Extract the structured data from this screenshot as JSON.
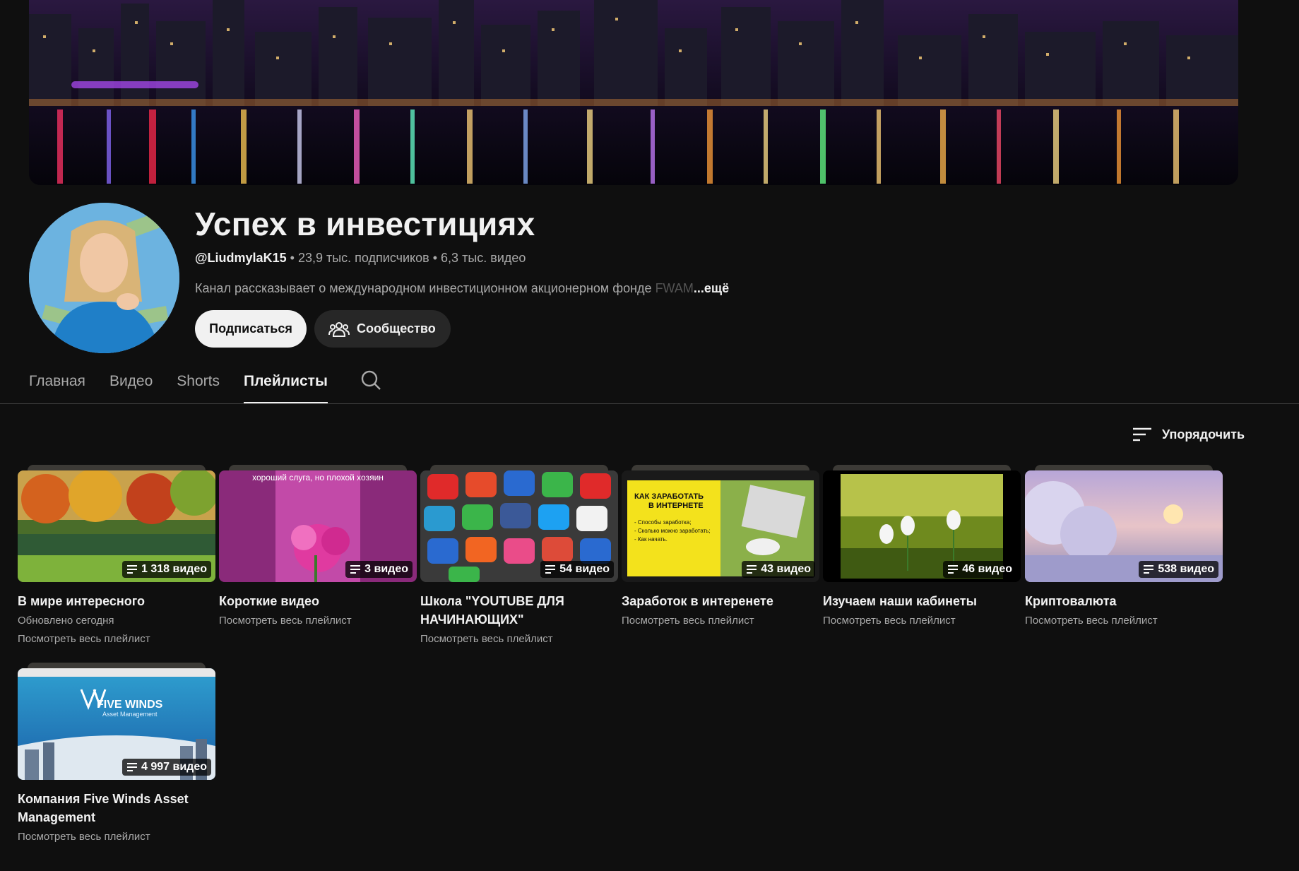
{
  "channel": {
    "title": "Успех в инвестициях",
    "handle": "@LiudmylaK15",
    "subscribers": "23,9 тыс. подписчиков",
    "videos": "6,3 тыс. видео",
    "separator": "•",
    "description": "Канал рассказывает о международном  инвестиционном акционерном фонде ",
    "description_faded": "FWAM",
    "more_label": "...ещё"
  },
  "buttons": {
    "subscribe": "Подписаться",
    "community": "Сообщество"
  },
  "tabs": [
    {
      "label": "Главная",
      "active": false
    },
    {
      "label": "Видео",
      "active": false
    },
    {
      "label": "Shorts",
      "active": false
    },
    {
      "label": "Плейлисты",
      "active": true
    }
  ],
  "sort_label": "Упорядочить",
  "playlists": [
    {
      "title": "В мире интересного",
      "count": "1 318 видео",
      "updated": "Обновлено сегодня",
      "link": "Посмотреть весь плейлист"
    },
    {
      "title": "Короткие видео",
      "count": "3 видео",
      "link": "Посмотреть весь плейлист",
      "thumb_text": "хороший слуга, но плохой хозяин"
    },
    {
      "title": "Школа   \"YOUTUBE ДЛЯ НАЧИНАЮЩИХ\"",
      "count": "54 видео",
      "link": "Посмотреть весь плейлист"
    },
    {
      "title": "Заработок в интеренете",
      "count": "43 видео",
      "link": "Посмотреть весь плейлист",
      "thumb_text": [
        "КАК ЗАРАБОТАТЬ",
        "В ИНТЕРНЕТЕ",
        "- Способы заработка;",
        "- Сколько можно заработать;",
        "- Как начать."
      ]
    },
    {
      "title": "Изучаем наши кабинеты",
      "count": "46 видео",
      "link": "Посмотреть весь плейлист"
    },
    {
      "title": "Криптовалюта",
      "count": "538 видео",
      "link": "Посмотреть весь плейлист"
    },
    {
      "title": "Компания Five Winds Asset Management",
      "count": "4 997 видео",
      "link": "Посмотреть весь плейлист",
      "thumb_text": [
        "FIVE WINDS",
        "Asset Management"
      ]
    }
  ],
  "colors": {
    "background": "#0f0f0f",
    "text_primary": "#f1f1f1",
    "text_secondary": "#aaaaaa",
    "subscribe_bg": "#f1f1f1",
    "chip_bg": "#272727"
  }
}
